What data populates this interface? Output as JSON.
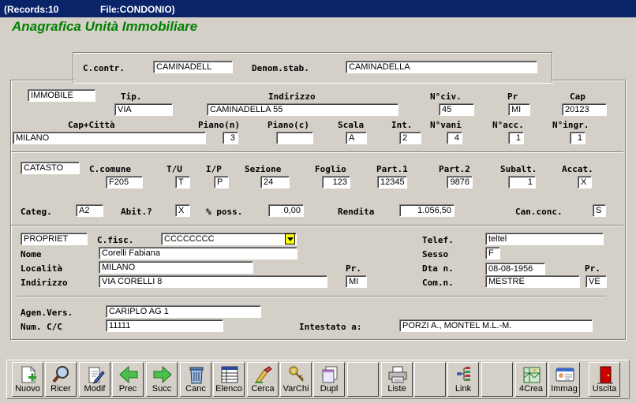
{
  "window": {
    "records": "(Records:10",
    "file": "File:CONDONIO)"
  },
  "app_title": "Anagrafica Unità Immobiliare",
  "condominio": {
    "contr_label": "C.contr.",
    "contr_value": "CAMINADELL",
    "denom_label": "Denom.stab.",
    "denom_value": "CAMINADELLA"
  },
  "immobile": {
    "section_value": "IMMOBILE",
    "tip_label": "Tip.",
    "tip_value": "VIA",
    "indirizzo_label": "Indirizzo",
    "indirizzo_value": "CAMINADELLA 55",
    "nciv_label": "N°civ.",
    "nciv_value": "45",
    "pr_label": "Pr",
    "pr_value": "MI",
    "cap_label": "Cap",
    "cap_value": "20123",
    "capcitta_label": "Cap+Città",
    "capcitta_value": "MILANO",
    "pianon_label": "Piano(n)",
    "pianon_value": "3",
    "pianoc_label": "Piano(c)",
    "pianoc_value": "",
    "scala_label": "Scala",
    "scala_value": "A",
    "int_label": "Int.",
    "int_value": "2",
    "nvani_label": "N°vani",
    "nvani_value": "4",
    "nacc_label": "N°acc.",
    "nacc_value": "1",
    "ningr_label": "N°ingr.",
    "ningr_value": "1"
  },
  "catasto": {
    "section_value": "CATASTO",
    "comune_label": "C.comune",
    "comune_value": "F205",
    "tu_label": "T/U",
    "tu_value": "T",
    "ip_label": "I/P",
    "ip_value": "P",
    "sezione_label": "Sezione",
    "sezione_value": "24",
    "foglio_label": "Foglio",
    "foglio_value": "123",
    "part1_label": "Part.1",
    "part1_value": "12345",
    "part2_label": "Part.2",
    "part2_value": "9876",
    "subalt_label": "Subalt.",
    "subalt_value": "1",
    "accat_label": "Accat.",
    "accat_value": "X",
    "categ_label": "Categ.",
    "categ_value": "A2",
    "abit_label": "Abit.?",
    "abit_value": "X",
    "poss_label": "% poss.",
    "poss_value": "0,00",
    "rendita_label": "Rendita",
    "rendita_value": "1.056,50",
    "canconc_label": "Can.conc.",
    "canconc_value": "S"
  },
  "proprietario": {
    "section_value": "PROPRIET",
    "cfisc_label": "C.fisc.",
    "cfisc_value": "CCCCCCCC",
    "telef_label": "Telef.",
    "telef_value": "teltel",
    "nome_label": "Nome",
    "nome_value": "Corelli Fabiana",
    "sesso_label": "Sesso",
    "sesso_value": "F",
    "localita_label": "Località",
    "localita_value": "MILANO",
    "pr_label": "Pr.",
    "pr_value": "MI",
    "dtan_label": "Dta n.",
    "dtan_value": "08-08-1956",
    "prn_label": "Pr.",
    "prn_value": "VE",
    "indirizzo_label": "Indirizzo",
    "indirizzo_value": "VIA CORELLI 8",
    "comn_label": "Com.n.",
    "comn_value": "MESTRE",
    "agen_label": "Agen.Vers.",
    "agen_value": "CARIPLO AG 1",
    "numcc_label": "Num. C/C",
    "numcc_value": "11111",
    "intestato_label": "Intestato a:",
    "intestato_value": "PORZI A., MONTEL M.L.-M."
  },
  "toolbar": {
    "nuovo": "Nuovo",
    "ricer": "Ricer",
    "modif": "Modif",
    "prec": "Prec",
    "succ": "Succ",
    "canc": "Canc",
    "elenco": "Elenco",
    "cerca": "Cerca",
    "varchi": "VarChi",
    "dupl": "Dupl",
    "liste": "Liste",
    "link": "Link",
    "crea4": "4Crea",
    "immag": "Immag",
    "uscita": "Uscita"
  },
  "colors": {
    "title_bar": "#0a246a",
    "app_title": "#008000",
    "dialog_bg": "#d4d0c8",
    "dropdown_button": "#ffff00",
    "exit_icon": "#cc0000"
  }
}
